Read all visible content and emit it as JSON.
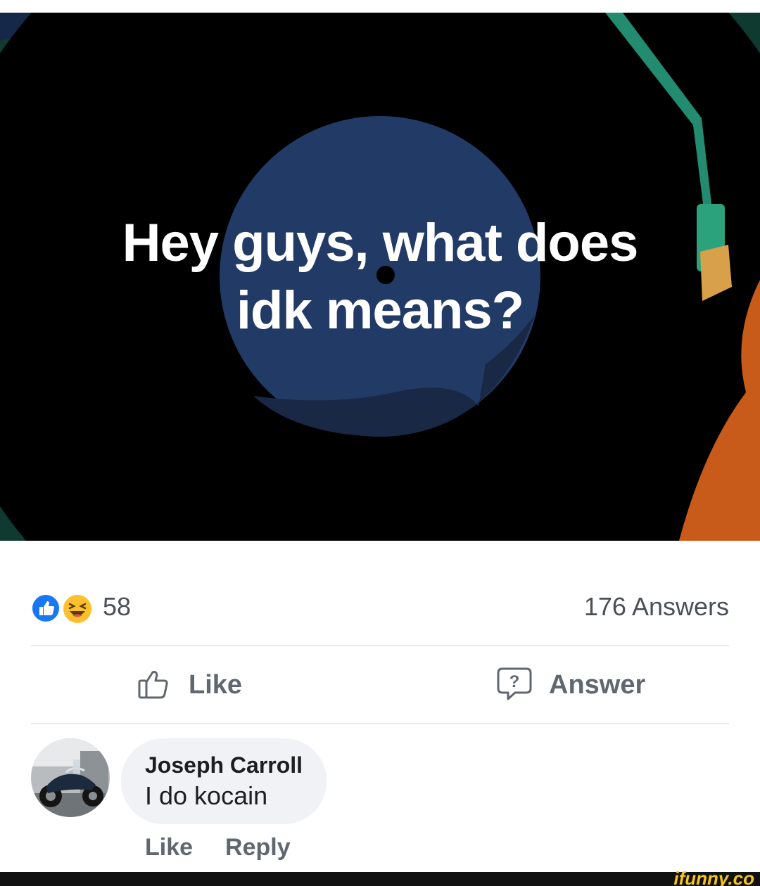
{
  "question": {
    "text_line1": "Hey guys, what does",
    "text_line2": "idk means?",
    "colors": {
      "outer": "#0f3a30",
      "record": "#000000",
      "label": "#223a66",
      "tonearm": "#238b6f",
      "accent": "#c85a1a"
    }
  },
  "stats": {
    "reaction_icons": [
      "like-icon",
      "haha-icon"
    ],
    "reaction_count": "58",
    "answers_count": "176 Answers"
  },
  "actions": {
    "like_label": "Like",
    "answer_label": "Answer"
  },
  "comment": {
    "author": "Joseph Carroll",
    "text": "I do kocain",
    "like_label": "Like",
    "reply_label": "Reply"
  },
  "watermark": "ifunny.co"
}
